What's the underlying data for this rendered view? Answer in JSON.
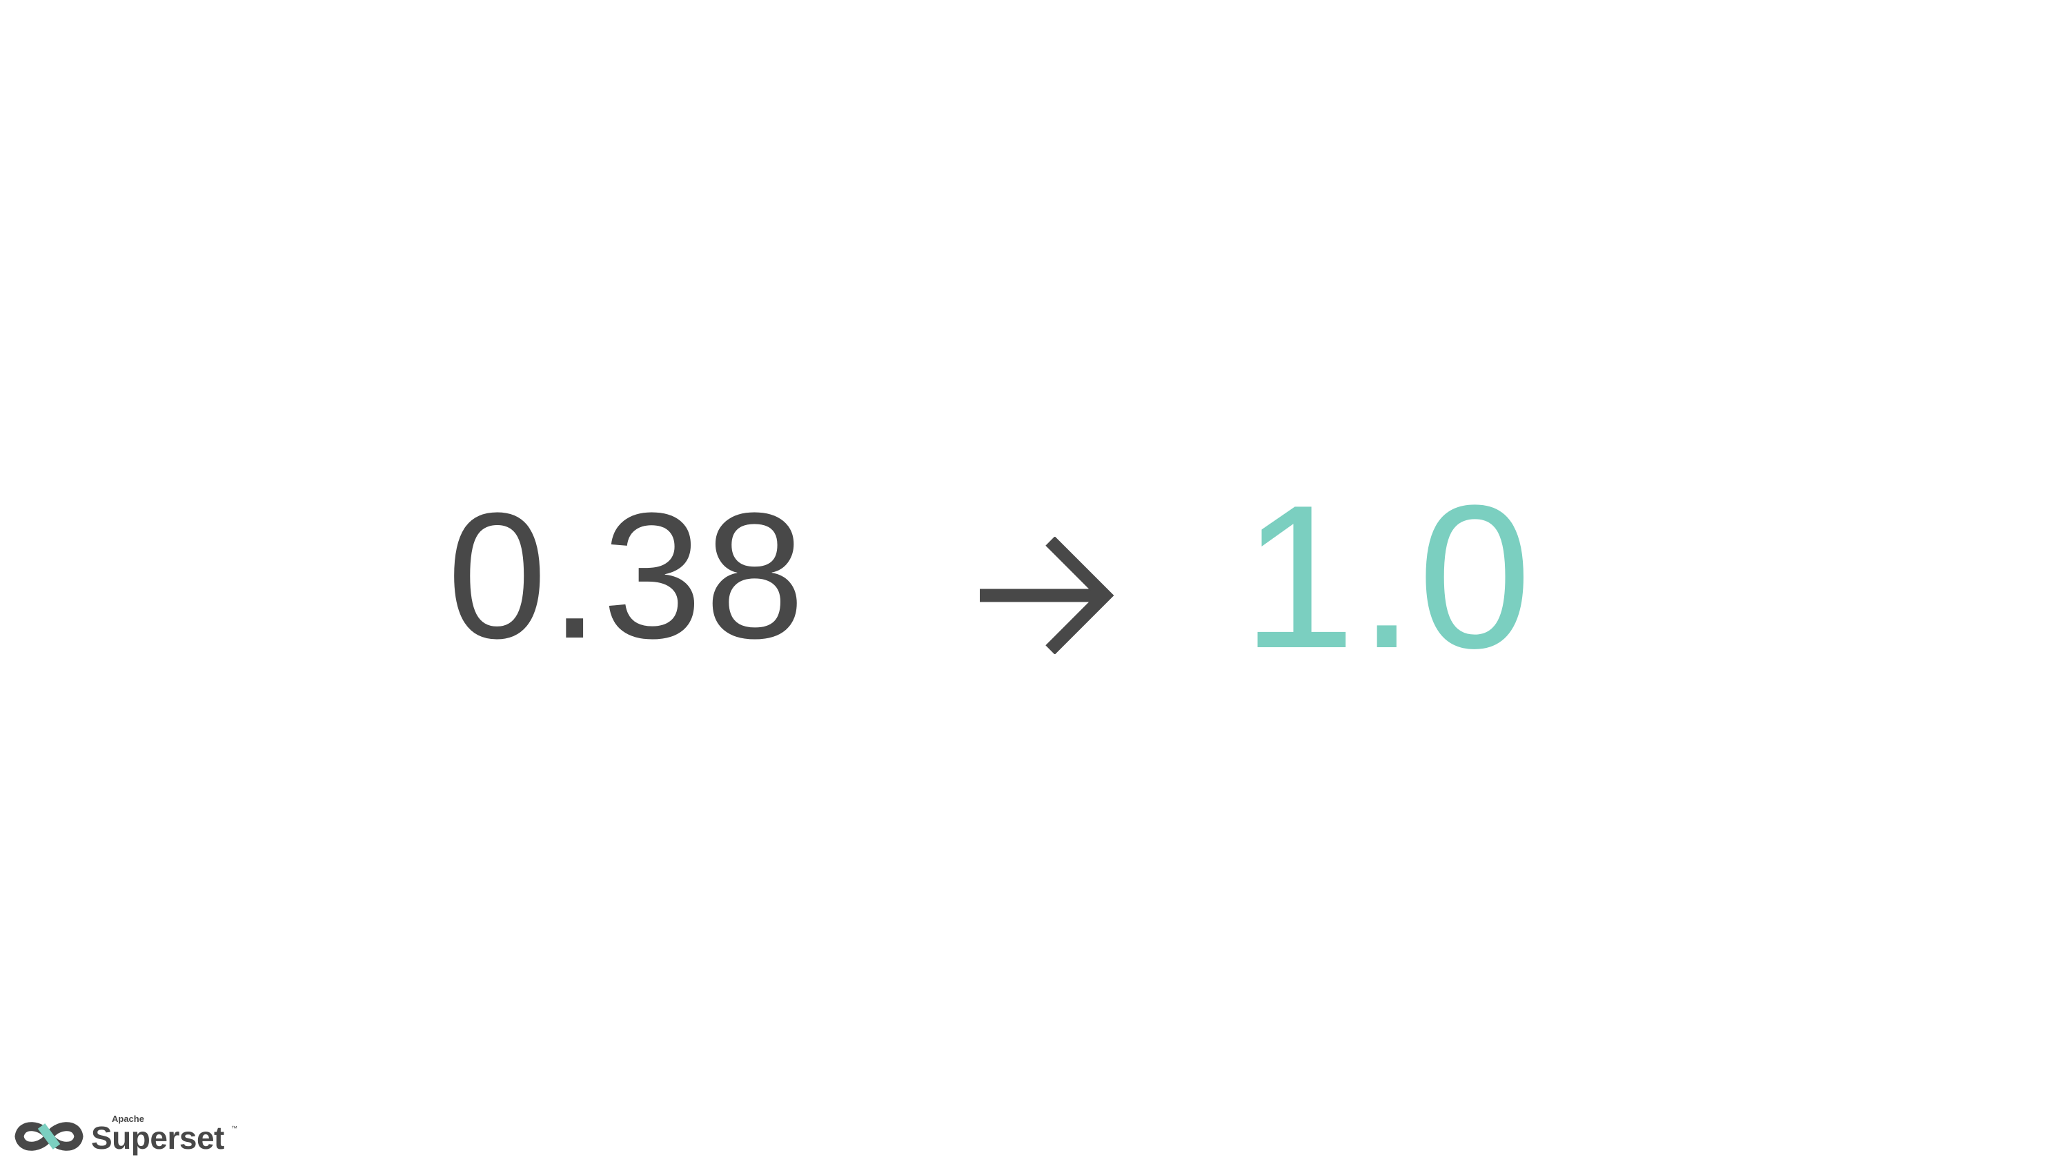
{
  "slide": {
    "from_version": "0.38",
    "to_version": "1.0",
    "arrow_icon": "arrow-right-icon"
  },
  "logo": {
    "apache": "Apache",
    "name": "Superset",
    "trademark": "™",
    "icon": "superset-infinity-logo"
  },
  "colors": {
    "text_dark": "#484848",
    "accent_teal": "#7bcfc0",
    "background": "#ffffff"
  }
}
